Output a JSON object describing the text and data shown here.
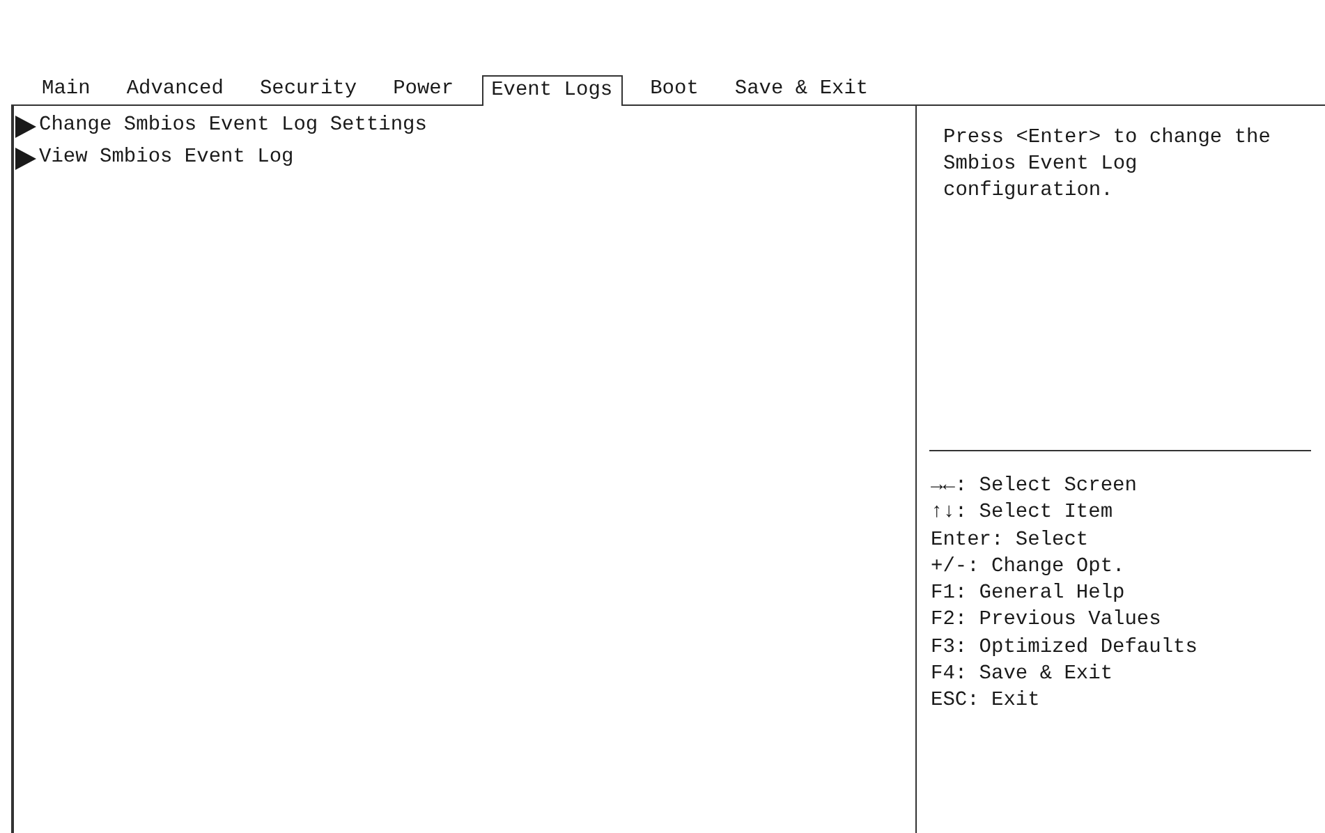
{
  "tabs": [
    {
      "label": "Main",
      "selected": false
    },
    {
      "label": "Advanced",
      "selected": false
    },
    {
      "label": "Security",
      "selected": false
    },
    {
      "label": "Power",
      "selected": false
    },
    {
      "label": "Event Logs",
      "selected": true
    },
    {
      "label": "Boot",
      "selected": false
    },
    {
      "label": "Save & Exit",
      "selected": false
    }
  ],
  "menu_items": [
    {
      "label": "Change Smbios Event Log Settings"
    },
    {
      "label": "View Smbios Event Log"
    }
  ],
  "help_text": "Press <Enter> to change the Smbios Event Log configuration.",
  "key_legend": [
    "→←: Select Screen",
    "↑↓: Select Item",
    "Enter: Select",
    "+/-: Change Opt.",
    "F1: General Help",
    "F2: Previous Values",
    "F3: Optimized Defaults",
    "F4: Save & Exit",
    "ESC: Exit"
  ]
}
